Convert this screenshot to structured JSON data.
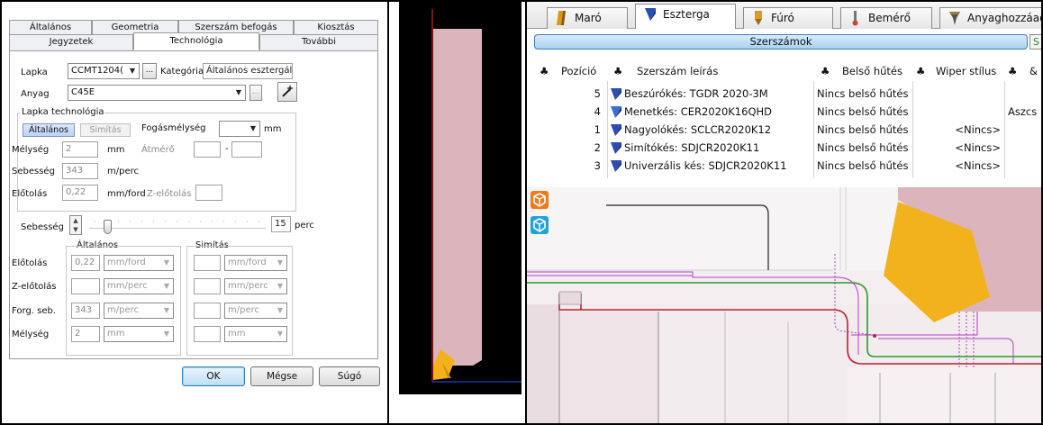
{
  "dialog": {
    "tabs_row1": [
      "Általános",
      "Geometria",
      "Szerszám befogás",
      "Kiosztás"
    ],
    "tabs_row2": [
      "Jegyzetek",
      "Technológia",
      "További"
    ],
    "lapka_label": "Lapka",
    "lapka_value": "CCMT1204(",
    "ellipsis": "...",
    "kategoria_label": "Kategória",
    "kategoria_value": "Általános esztergálás",
    "anyag_label": "Anyag",
    "anyag_value": "C45E",
    "lapka_tech_title": "Lapka technológia",
    "seg_general": "Általános",
    "seg_finish": "Simítás",
    "fogasmelyseg_label": "Fogásmélység",
    "unit_mm": "mm",
    "melyseg_label": "Mélység",
    "melyseg_value": "2",
    "atmero_label": "Átmérő",
    "dash": "-",
    "sebesseg_label": "Sebesség",
    "sebesseg_value": "343",
    "unit_mperc": "m/perc",
    "elotolas_label": "Előtolás",
    "elotolas_value": "0,22",
    "unit_mmford": "mm/ford",
    "zelotolas_label": "Z-előtolás",
    "slider_label": "Sebesség",
    "slider_value": "15",
    "slider_unit": "perc",
    "col_general": "Általános",
    "col_finish": "Simítás",
    "grid_rows": [
      {
        "label": "Előtolás",
        "gen_value": "0,22",
        "gen_unit": "mm/ford",
        "fin_value": "",
        "fin_unit": "mm/ford"
      },
      {
        "label": "Z-előtolás",
        "gen_value": "",
        "gen_unit": "mm/perc",
        "fin_value": "",
        "fin_unit": "mm/perc"
      },
      {
        "label": "Forg. seb.",
        "gen_value": "343",
        "gen_unit": "m/perc",
        "fin_value": "",
        "fin_unit": "m/perc"
      },
      {
        "label": "Mélység",
        "gen_value": "2",
        "gen_unit": "mm",
        "fin_value": "",
        "fin_unit": "mm"
      }
    ],
    "ok_label": "OK",
    "cancel_label": "Mégse",
    "help_label": "Súgó"
  },
  "right": {
    "tabs": [
      {
        "label": "Maró",
        "icon": "mill-icon",
        "color": "#d89a1a"
      },
      {
        "label": "Eszterga",
        "icon": "turning-tool-icon",
        "color": "#2a4fb0"
      },
      {
        "label": "Fúró",
        "icon": "drill-icon",
        "color": "#d8a020"
      },
      {
        "label": "Bemérő",
        "icon": "probe-icon",
        "color": "#c8462a"
      },
      {
        "label": "Anyaghozzáad",
        "icon": "additive-icon",
        "color": "#555555"
      }
    ],
    "tools_label": "Szerszámok",
    "columns": {
      "position": "Pozíció",
      "desc": "Szerszám leírás",
      "cooling": "Belső hűtés",
      "wiper": "Wiper stílus",
      "extra": "&"
    },
    "rows": [
      {
        "pos": "5",
        "desc": "Beszúrókés: TGDR 2020-3M",
        "cooling": "Nincs belső hűtés",
        "wiper": "",
        "extra": ""
      },
      {
        "pos": "4",
        "desc": "Menetkés: CER2020K16QHD",
        "cooling": "Nincs belső hűtés",
        "wiper": "",
        "extra": "Aszcs"
      },
      {
        "pos": "1",
        "desc": "Nagyolókés: SCLCR2020K12",
        "cooling": "Nincs belső hűtés",
        "wiper": "<Nincs>",
        "extra": ""
      },
      {
        "pos": "2",
        "desc": "Simítókés: SDJCR2020K11",
        "cooling": "Nincs belső hűtés",
        "wiper": "<Nincs>",
        "extra": ""
      },
      {
        "pos": "3",
        "desc": "Univerzális kés: SDJCR2020K11",
        "cooling": "Nincs belső hűtés",
        "wiper": "<Nincs>",
        "extra": ""
      }
    ]
  },
  "colors": {
    "insert": "#f2b21c",
    "holder": "#dcb4bc",
    "green_path": "#2a9a2a",
    "red_contour": "#c0202a",
    "purple_path": "#b040c0"
  }
}
